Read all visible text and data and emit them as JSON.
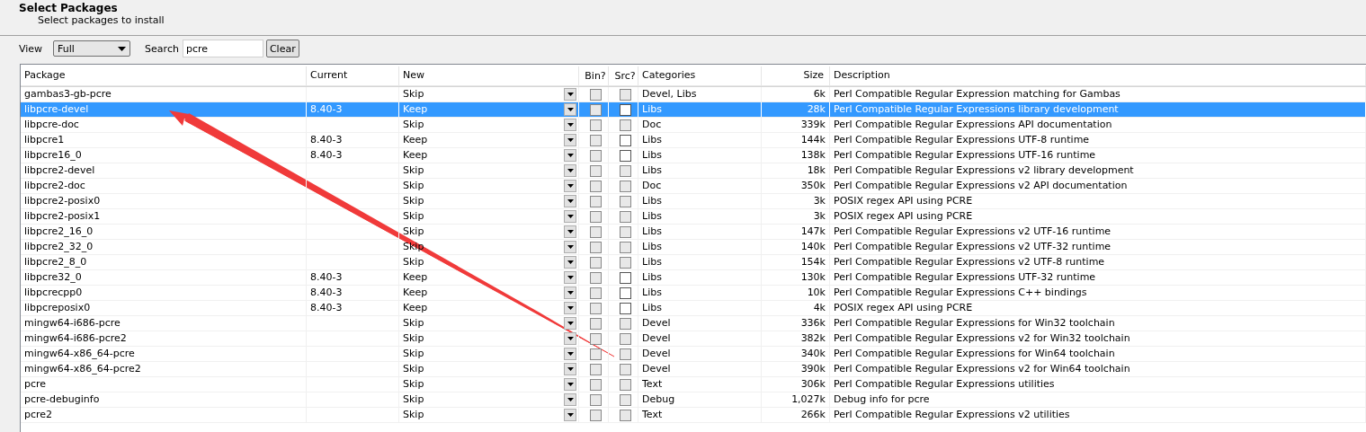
{
  "header": {
    "title": "Select Packages",
    "subtitle": "Select packages to install"
  },
  "toolbar": {
    "view_label": "View",
    "view_value": "Full",
    "search_label": "Search",
    "search_value": "pcre",
    "clear_button": "Clear"
  },
  "table": {
    "columns": [
      "Package",
      "Current",
      "New",
      "Bin?",
      "Src?",
      "Categories",
      "Size",
      "Description"
    ],
    "rows": [
      {
        "package": "gambas3-gb-pcre",
        "current": "",
        "new": "Skip",
        "src_disabled": true,
        "categories": "Devel, Libs",
        "size": "6k",
        "description": "Perl Compatible Regular Expression matching for Gambas",
        "selected": false
      },
      {
        "package": "libpcre-devel",
        "current": "8.40-3",
        "new": "Keep",
        "src_disabled": false,
        "categories": "Libs",
        "size": "28k",
        "description": "Perl Compatible Regular Expressions library development",
        "selected": true
      },
      {
        "package": "libpcre-doc",
        "current": "",
        "new": "Skip",
        "src_disabled": true,
        "categories": "Doc",
        "size": "339k",
        "description": "Perl Compatible Regular Expressions API documentation",
        "selected": false
      },
      {
        "package": "libpcre1",
        "current": "8.40-3",
        "new": "Keep",
        "src_disabled": false,
        "categories": "Libs",
        "size": "144k",
        "description": "Perl Compatible Regular Expressions UTF-8 runtime",
        "selected": false
      },
      {
        "package": "libpcre16_0",
        "current": "8.40-3",
        "new": "Keep",
        "src_disabled": false,
        "categories": "Libs",
        "size": "138k",
        "description": "Perl Compatible Regular Expressions UTF-16 runtime",
        "selected": false
      },
      {
        "package": "libpcre2-devel",
        "current": "",
        "new": "Skip",
        "src_disabled": true,
        "categories": "Libs",
        "size": "18k",
        "description": "Perl Compatible Regular Expressions v2 library development",
        "selected": false
      },
      {
        "package": "libpcre2-doc",
        "current": "",
        "new": "Skip",
        "src_disabled": true,
        "categories": "Doc",
        "size": "350k",
        "description": "Perl Compatible Regular Expressions v2 API documentation",
        "selected": false
      },
      {
        "package": "libpcre2-posix0",
        "current": "",
        "new": "Skip",
        "src_disabled": true,
        "categories": "Libs",
        "size": "3k",
        "description": "POSIX regex API using PCRE",
        "selected": false
      },
      {
        "package": "libpcre2-posix1",
        "current": "",
        "new": "Skip",
        "src_disabled": true,
        "categories": "Libs",
        "size": "3k",
        "description": "POSIX regex API using PCRE",
        "selected": false
      },
      {
        "package": "libpcre2_16_0",
        "current": "",
        "new": "Skip",
        "src_disabled": true,
        "categories": "Libs",
        "size": "147k",
        "description": "Perl Compatible Regular Expressions v2 UTF-16 runtime",
        "selected": false
      },
      {
        "package": "libpcre2_32_0",
        "current": "",
        "new": "Skip",
        "src_disabled": true,
        "categories": "Libs",
        "size": "140k",
        "description": "Perl Compatible Regular Expressions v2 UTF-32 runtime",
        "selected": false
      },
      {
        "package": "libpcre2_8_0",
        "current": "",
        "new": "Skip",
        "src_disabled": true,
        "categories": "Libs",
        "size": "154k",
        "description": "Perl Compatible Regular Expressions v2 UTF-8 runtime",
        "selected": false
      },
      {
        "package": "libpcre32_0",
        "current": "8.40-3",
        "new": "Keep",
        "src_disabled": false,
        "categories": "Libs",
        "size": "130k",
        "description": "Perl Compatible Regular Expressions UTF-32 runtime",
        "selected": false
      },
      {
        "package": "libpcrecpp0",
        "current": "8.40-3",
        "new": "Keep",
        "src_disabled": false,
        "categories": "Libs",
        "size": "10k",
        "description": "Perl Compatible Regular Expressions C++ bindings",
        "selected": false
      },
      {
        "package": "libpcreposix0",
        "current": "8.40-3",
        "new": "Keep",
        "src_disabled": false,
        "categories": "Libs",
        "size": "4k",
        "description": "POSIX regex API using PCRE",
        "selected": false
      },
      {
        "package": "mingw64-i686-pcre",
        "current": "",
        "new": "Skip",
        "src_disabled": true,
        "categories": "Devel",
        "size": "336k",
        "description": "Perl Compatible Regular Expressions for Win32 toolchain",
        "selected": false
      },
      {
        "package": "mingw64-i686-pcre2",
        "current": "",
        "new": "Skip",
        "src_disabled": true,
        "categories": "Devel",
        "size": "382k",
        "description": "Perl Compatible Regular Expressions v2 for Win32 toolchain",
        "selected": false
      },
      {
        "package": "mingw64-x86_64-pcre",
        "current": "",
        "new": "Skip",
        "src_disabled": true,
        "categories": "Devel",
        "size": "340k",
        "description": "Perl Compatible Regular Expressions for Win64 toolchain",
        "selected": false
      },
      {
        "package": "mingw64-x86_64-pcre2",
        "current": "",
        "new": "Skip",
        "src_disabled": true,
        "categories": "Devel",
        "size": "390k",
        "description": "Perl Compatible Regular Expressions v2 for Win64 toolchain",
        "selected": false
      },
      {
        "package": "pcre",
        "current": "",
        "new": "Skip",
        "src_disabled": true,
        "categories": "Text",
        "size": "306k",
        "description": "Perl Compatible Regular Expressions utilities",
        "selected": false
      },
      {
        "package": "pcre-debuginfo",
        "current": "",
        "new": "Skip",
        "src_disabled": true,
        "categories": "Debug",
        "size": "1,027k",
        "description": "Debug info for pcre",
        "selected": false
      },
      {
        "package": "pcre2",
        "current": "",
        "new": "Skip",
        "src_disabled": true,
        "categories": "Text",
        "size": "266k",
        "description": "Perl Compatible Regular Expressions v2 utilities",
        "selected": false
      }
    ]
  }
}
